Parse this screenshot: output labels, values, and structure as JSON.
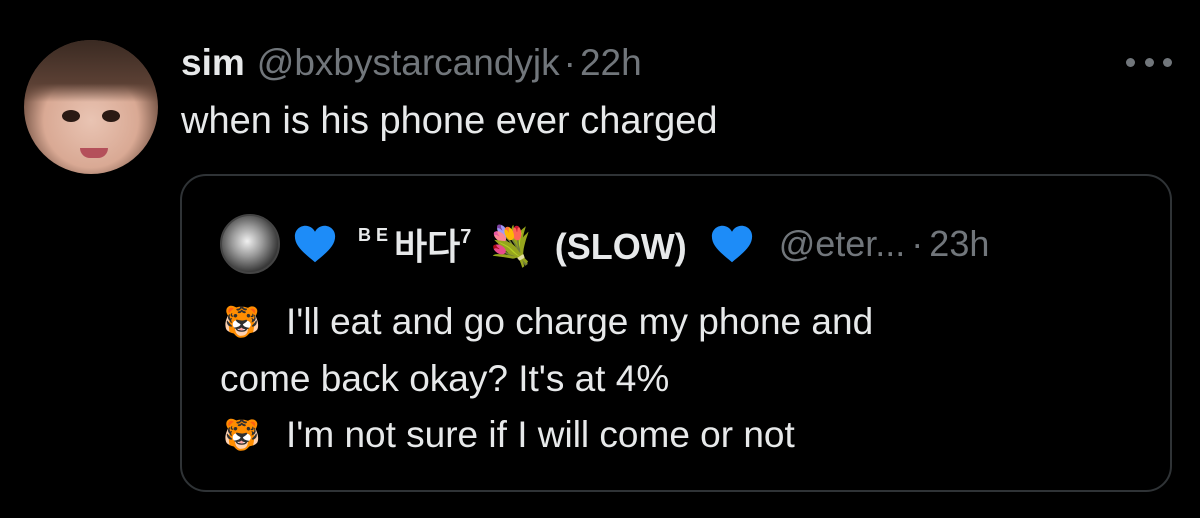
{
  "tweet": {
    "author_name": "sim",
    "author_handle": "@bxbystarcandyjk",
    "separator": "·",
    "time": "22h",
    "text": "when is his phone ever charged"
  },
  "quoted_tweet": {
    "name_prefix_small": "B E",
    "name_korean": "바다",
    "name_superscript": "7",
    "name_emoji": "💐",
    "name_suffix": "(SLOW)",
    "handle": "@eter...",
    "separator": "·",
    "time": "23h",
    "lines": [
      {
        "emoji": "🐯",
        "text": "I'll eat and go charge my phone and"
      },
      {
        "emoji": "",
        "text": "come back okay? It's at 4%"
      },
      {
        "emoji": "🐯",
        "text": "I'm not sure if I will come or not"
      }
    ]
  },
  "icons": {
    "more": "more-options-icon",
    "heart": "blue-heart-icon",
    "tiger": "tiger-face-icon",
    "bouquet": "bouquet-icon"
  },
  "colors": {
    "background": "#000000",
    "text_primary": "#e7e9ea",
    "text_secondary": "#71767b",
    "border": "#2f3336",
    "heart": "#1d8cf8"
  }
}
